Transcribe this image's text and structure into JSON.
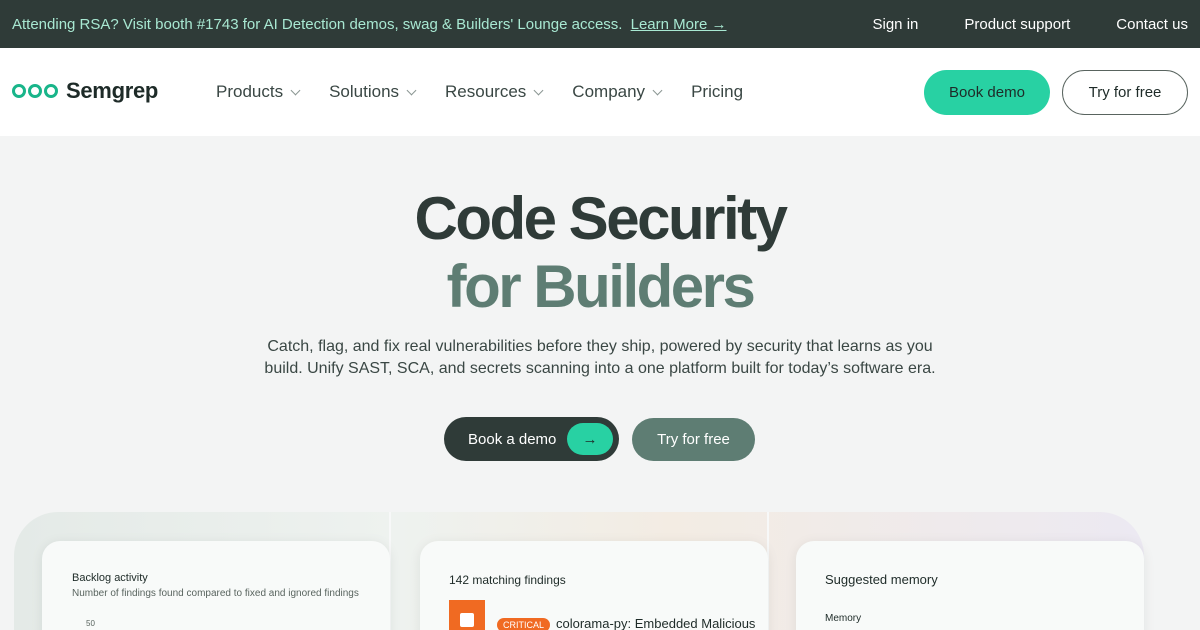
{
  "announcement": {
    "text": "Attending RSA? Visit booth #1743 for AI Detection demos, swag & Builders' Lounge access.",
    "link": "Learn More →"
  },
  "top_links": [
    "Sign in",
    "Product support",
    "Contact us"
  ],
  "brand": {
    "name": "Semgrep",
    "accent": "#28d1a3"
  },
  "nav": {
    "items": [
      {
        "label": "Products",
        "has_dropdown": true
      },
      {
        "label": "Solutions",
        "has_dropdown": true
      },
      {
        "label": "Resources",
        "has_dropdown": true
      },
      {
        "label": "Company",
        "has_dropdown": true
      },
      {
        "label": "Pricing",
        "has_dropdown": false
      }
    ],
    "book_demo": "Book demo",
    "try_free": "Try for free"
  },
  "hero": {
    "line1": "Code Security",
    "line2": "for Builders",
    "subtitle": "Catch, flag, and fix real vulnerabilities before they ship, powered by security that learns as you build. Unify SAST, SCA, and secrets scanning into a one platform built for today’s software era.",
    "cta_demo": "Book a demo",
    "cta_arrow": "→",
    "cta_try": "Try for free"
  },
  "previews": {
    "backlog": {
      "title": "Backlog activity",
      "subtitle": "Number of findings found compared to fixed and ignored findings",
      "y_tick": "50"
    },
    "findings": {
      "count_label": "142 matching findings",
      "severity": "CRITICAL",
      "title": "colorama-py: Embedded Malicious"
    },
    "memory": {
      "title": "Suggested memory",
      "label": "Memory"
    }
  }
}
